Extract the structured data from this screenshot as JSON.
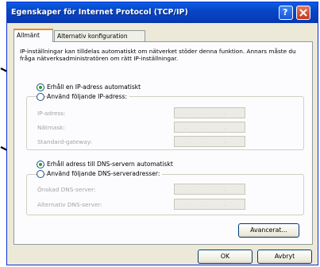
{
  "window": {
    "title": "Egenskaper för Internet Protocol (TCP/IP)"
  },
  "titlebar_buttons": {
    "help": "?",
    "close_icon": "close-icon"
  },
  "tabs": [
    {
      "label": "Allmänt",
      "active": true
    },
    {
      "label": "Alternativ konfiguration",
      "active": false
    }
  ],
  "intro_text": "IP-inställningar kan tilldelas automatiskt om nätverket stöder denna funktion. Annars måste du fråga nätverksadministratören om rätt IP-inställningar.",
  "ip": {
    "auto_label": "Erhåll en IP-adress automatiskt",
    "manual_label": "Använd följande IP-adress:",
    "selected": "auto",
    "fields": [
      {
        "label": "IP-adress:",
        "value": ". . ."
      },
      {
        "label": "Nätmask:",
        "value": ". . ."
      },
      {
        "label": "Standard-gateway:",
        "value": ". . ."
      }
    ]
  },
  "dns": {
    "auto_label": "Erhåll adress till DNS-servern automatiskt",
    "manual_label": "Använd följande DNS-serveradresser:",
    "selected": "auto",
    "fields": [
      {
        "label": "Önskad DNS-server:",
        "value": ". . ."
      },
      {
        "label": "Alternativ DNS-server:",
        "value": ". . ."
      }
    ]
  },
  "buttons": {
    "advanced": "Avancerat...",
    "ok": "OK",
    "cancel": "Avbryt"
  },
  "colors": {
    "titlebar": "#0a5fe3",
    "dialog_bg": "#ece9d8",
    "radio_dot": "#21a121",
    "tab_highlight": "#e68b2c"
  }
}
